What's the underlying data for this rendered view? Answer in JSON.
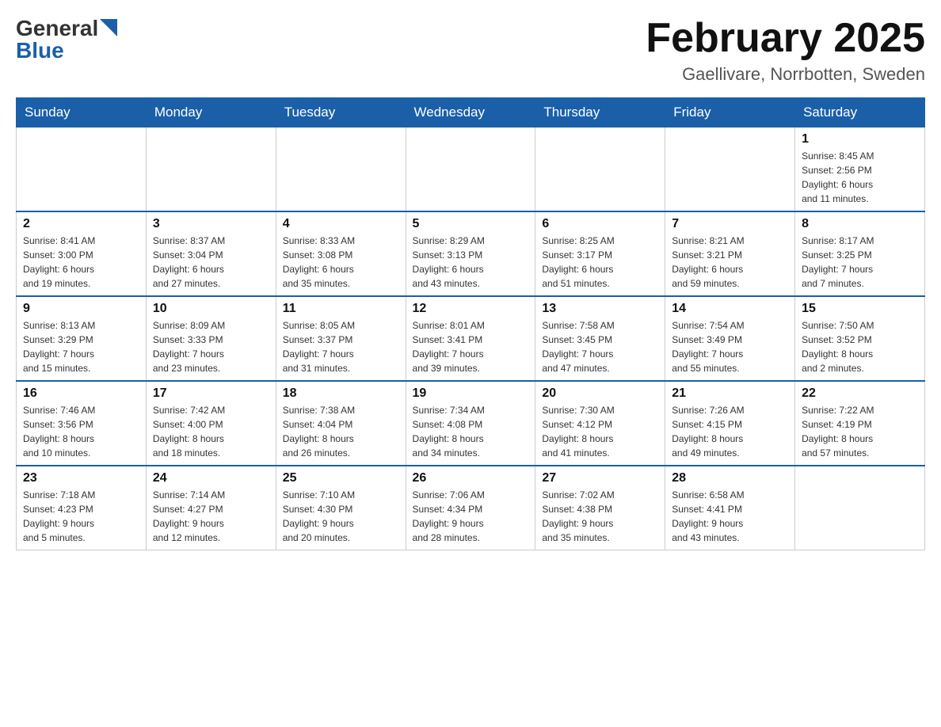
{
  "header": {
    "logo_general": "General",
    "logo_blue": "Blue",
    "title": "February 2025",
    "location": "Gaellivare, Norrbotten, Sweden"
  },
  "days_of_week": [
    "Sunday",
    "Monday",
    "Tuesday",
    "Wednesday",
    "Thursday",
    "Friday",
    "Saturday"
  ],
  "weeks": [
    [
      {
        "day": "",
        "info": ""
      },
      {
        "day": "",
        "info": ""
      },
      {
        "day": "",
        "info": ""
      },
      {
        "day": "",
        "info": ""
      },
      {
        "day": "",
        "info": ""
      },
      {
        "day": "",
        "info": ""
      },
      {
        "day": "1",
        "info": "Sunrise: 8:45 AM\nSunset: 2:56 PM\nDaylight: 6 hours\nand 11 minutes."
      }
    ],
    [
      {
        "day": "2",
        "info": "Sunrise: 8:41 AM\nSunset: 3:00 PM\nDaylight: 6 hours\nand 19 minutes."
      },
      {
        "day": "3",
        "info": "Sunrise: 8:37 AM\nSunset: 3:04 PM\nDaylight: 6 hours\nand 27 minutes."
      },
      {
        "day": "4",
        "info": "Sunrise: 8:33 AM\nSunset: 3:08 PM\nDaylight: 6 hours\nand 35 minutes."
      },
      {
        "day": "5",
        "info": "Sunrise: 8:29 AM\nSunset: 3:13 PM\nDaylight: 6 hours\nand 43 minutes."
      },
      {
        "day": "6",
        "info": "Sunrise: 8:25 AM\nSunset: 3:17 PM\nDaylight: 6 hours\nand 51 minutes."
      },
      {
        "day": "7",
        "info": "Sunrise: 8:21 AM\nSunset: 3:21 PM\nDaylight: 6 hours\nand 59 minutes."
      },
      {
        "day": "8",
        "info": "Sunrise: 8:17 AM\nSunset: 3:25 PM\nDaylight: 7 hours\nand 7 minutes."
      }
    ],
    [
      {
        "day": "9",
        "info": "Sunrise: 8:13 AM\nSunset: 3:29 PM\nDaylight: 7 hours\nand 15 minutes."
      },
      {
        "day": "10",
        "info": "Sunrise: 8:09 AM\nSunset: 3:33 PM\nDaylight: 7 hours\nand 23 minutes."
      },
      {
        "day": "11",
        "info": "Sunrise: 8:05 AM\nSunset: 3:37 PM\nDaylight: 7 hours\nand 31 minutes."
      },
      {
        "day": "12",
        "info": "Sunrise: 8:01 AM\nSunset: 3:41 PM\nDaylight: 7 hours\nand 39 minutes."
      },
      {
        "day": "13",
        "info": "Sunrise: 7:58 AM\nSunset: 3:45 PM\nDaylight: 7 hours\nand 47 minutes."
      },
      {
        "day": "14",
        "info": "Sunrise: 7:54 AM\nSunset: 3:49 PM\nDaylight: 7 hours\nand 55 minutes."
      },
      {
        "day": "15",
        "info": "Sunrise: 7:50 AM\nSunset: 3:52 PM\nDaylight: 8 hours\nand 2 minutes."
      }
    ],
    [
      {
        "day": "16",
        "info": "Sunrise: 7:46 AM\nSunset: 3:56 PM\nDaylight: 8 hours\nand 10 minutes."
      },
      {
        "day": "17",
        "info": "Sunrise: 7:42 AM\nSunset: 4:00 PM\nDaylight: 8 hours\nand 18 minutes."
      },
      {
        "day": "18",
        "info": "Sunrise: 7:38 AM\nSunset: 4:04 PM\nDaylight: 8 hours\nand 26 minutes."
      },
      {
        "day": "19",
        "info": "Sunrise: 7:34 AM\nSunset: 4:08 PM\nDaylight: 8 hours\nand 34 minutes."
      },
      {
        "day": "20",
        "info": "Sunrise: 7:30 AM\nSunset: 4:12 PM\nDaylight: 8 hours\nand 41 minutes."
      },
      {
        "day": "21",
        "info": "Sunrise: 7:26 AM\nSunset: 4:15 PM\nDaylight: 8 hours\nand 49 minutes."
      },
      {
        "day": "22",
        "info": "Sunrise: 7:22 AM\nSunset: 4:19 PM\nDaylight: 8 hours\nand 57 minutes."
      }
    ],
    [
      {
        "day": "23",
        "info": "Sunrise: 7:18 AM\nSunset: 4:23 PM\nDaylight: 9 hours\nand 5 minutes."
      },
      {
        "day": "24",
        "info": "Sunrise: 7:14 AM\nSunset: 4:27 PM\nDaylight: 9 hours\nand 12 minutes."
      },
      {
        "day": "25",
        "info": "Sunrise: 7:10 AM\nSunset: 4:30 PM\nDaylight: 9 hours\nand 20 minutes."
      },
      {
        "day": "26",
        "info": "Sunrise: 7:06 AM\nSunset: 4:34 PM\nDaylight: 9 hours\nand 28 minutes."
      },
      {
        "day": "27",
        "info": "Sunrise: 7:02 AM\nSunset: 4:38 PM\nDaylight: 9 hours\nand 35 minutes."
      },
      {
        "day": "28",
        "info": "Sunrise: 6:58 AM\nSunset: 4:41 PM\nDaylight: 9 hours\nand 43 minutes."
      },
      {
        "day": "",
        "info": ""
      }
    ]
  ]
}
